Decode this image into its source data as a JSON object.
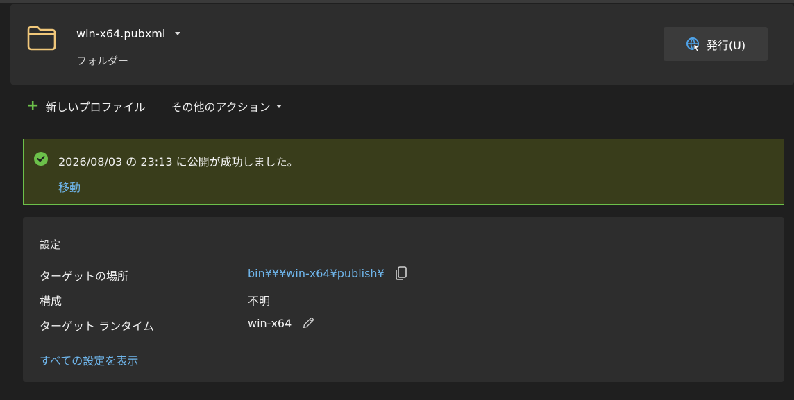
{
  "header": {
    "profile_name": "win-x64.pubxml",
    "profile_type": "フォルダー",
    "publish_button": "発行(U)"
  },
  "actions": {
    "new_profile": "新しいプロファイル",
    "other_actions": "その他のアクション"
  },
  "banner": {
    "message": "2026/08/03 の 23:13 に公開が成功しました。",
    "link": "移動",
    "accent_color": "#6cc04a"
  },
  "settings": {
    "title": "設定",
    "rows": [
      {
        "label": "ターゲットの場所",
        "value": "bin¥¥¥win-x64¥publish¥"
      },
      {
        "label": "構成",
        "value": "不明"
      },
      {
        "label": "ターゲット ランタイム",
        "value": "win-x64"
      }
    ],
    "show_all": "すべての設定を表示"
  },
  "icons": {
    "folder": "folder-icon",
    "publish": "globe-publish-icon",
    "plus": "plus-icon",
    "caret": "chevron-down-icon",
    "success": "check-circle-icon",
    "copy": "copy-icon",
    "edit": "pencil-icon"
  }
}
